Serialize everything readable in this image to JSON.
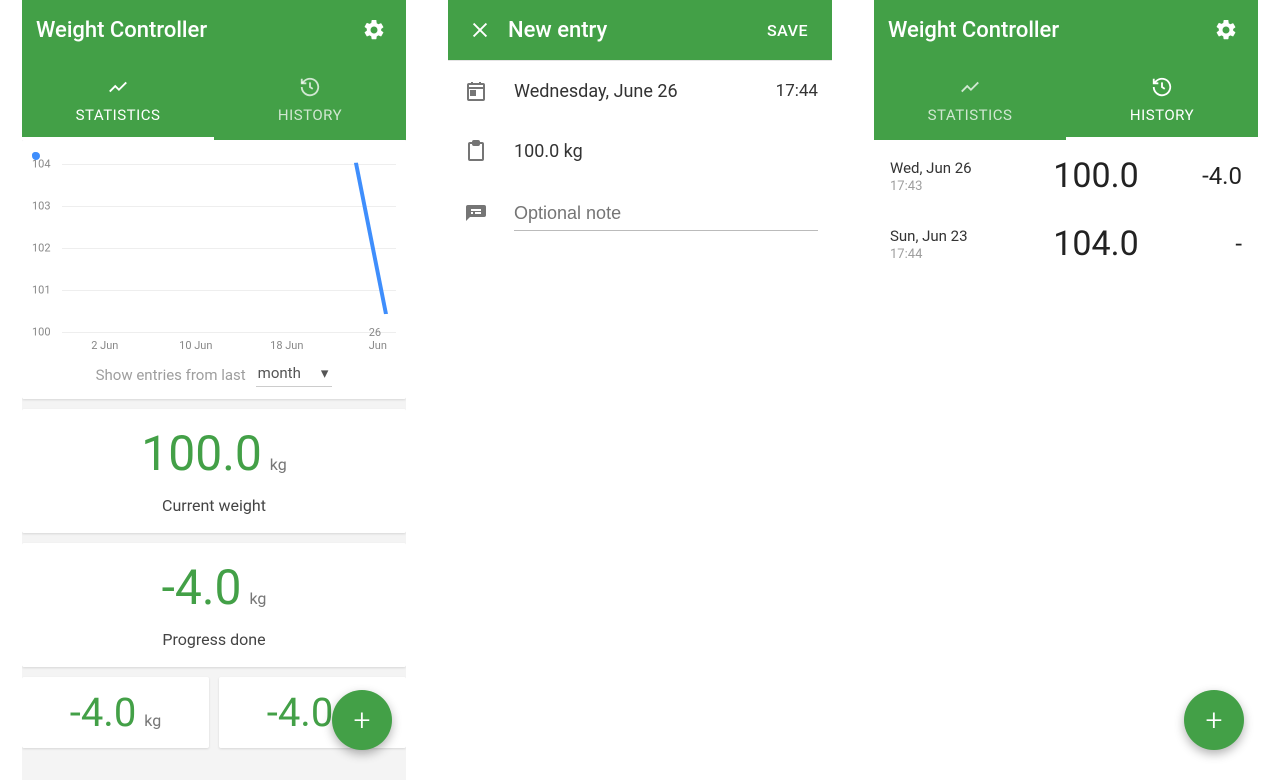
{
  "colors": {
    "primary": "#43a047"
  },
  "chart_data": {
    "type": "line",
    "x": [
      "23 Jun",
      "26 Jun"
    ],
    "values": [
      104,
      100
    ],
    "ylim": [
      100,
      104
    ],
    "yticks": [
      100,
      101,
      102,
      103,
      104
    ],
    "xticks": [
      "2 Jun",
      "10 Jun",
      "18 Jun",
      "26 Jun"
    ],
    "xlabel": "",
    "ylabel": "",
    "title": ""
  },
  "screen1": {
    "title": "Weight Controller",
    "tabs": {
      "statistics": "STATISTICS",
      "history": "HISTORY",
      "active": "statistics"
    },
    "range_label": "Show entries from last",
    "range_value": "month",
    "current_weight": {
      "value": "100.0",
      "unit": "kg",
      "label": "Current weight"
    },
    "progress": {
      "value": "-4.0",
      "unit": "kg",
      "label": "Progress done"
    },
    "mini_left": {
      "value": "-4.0",
      "unit": "kg"
    },
    "mini_right": {
      "value": "-4.0",
      "unit": "kg"
    }
  },
  "screen2": {
    "title": "New entry",
    "save": "SAVE",
    "date": "Wednesday, June 26",
    "time": "17:44",
    "weight": "100.0 kg",
    "note_placeholder": "Optional note"
  },
  "screen3": {
    "title": "Weight Controller",
    "tabs": {
      "statistics": "STATISTICS",
      "history": "HISTORY",
      "active": "history"
    },
    "rows": [
      {
        "date": "Wed, Jun 26",
        "time": "17:43",
        "weight": "100.0",
        "delta": "-4.0"
      },
      {
        "date": "Sun, Jun 23",
        "time": "17:44",
        "weight": "104.0",
        "delta": "-"
      }
    ]
  }
}
